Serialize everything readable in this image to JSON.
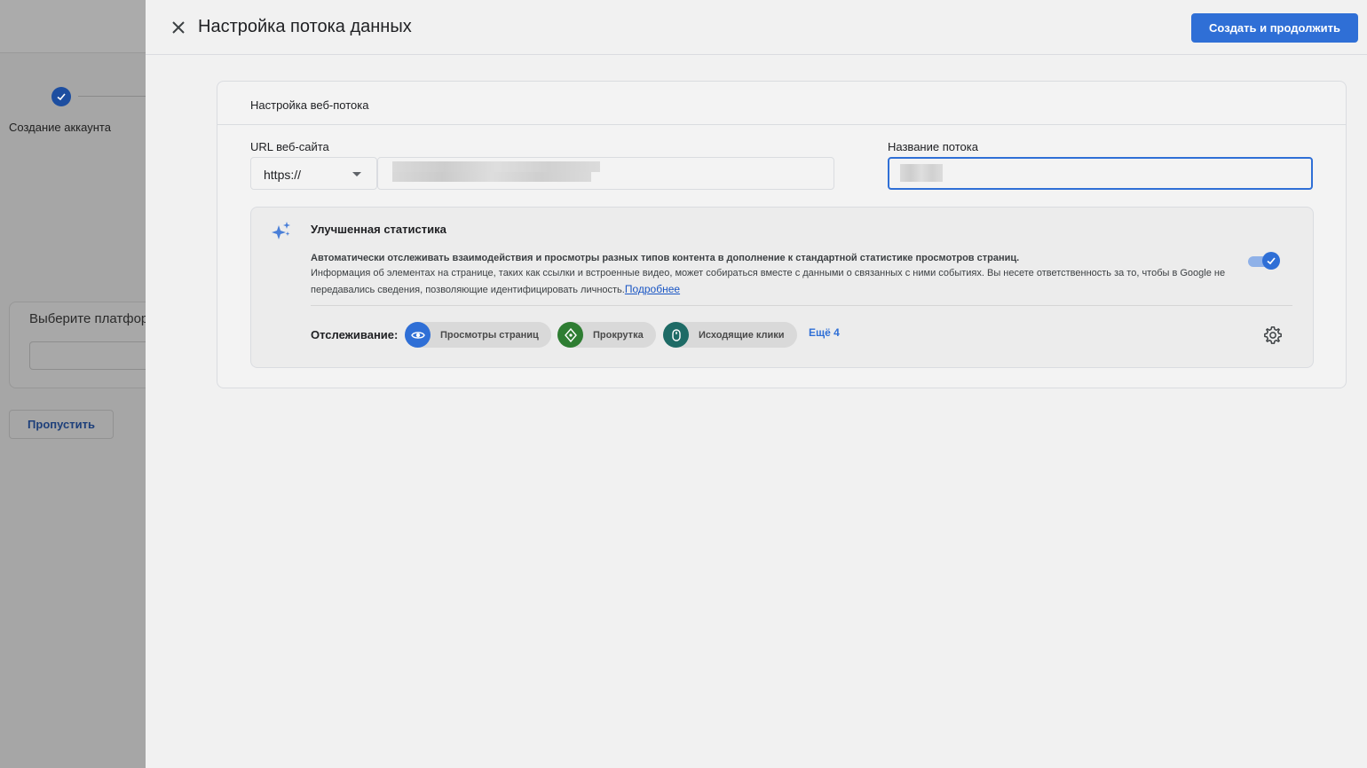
{
  "background": {
    "step_label": "Создание аккаунта",
    "platform_title": "Выберите платфор",
    "skip_button": "Пропустить"
  },
  "header": {
    "title": "Настройка потока данных",
    "primary_button": "Создать и продолжить",
    "close_icon": "close-icon"
  },
  "card": {
    "title": "Настройка веб-потока",
    "url_label": "URL веб-сайта",
    "protocol_value": "https://",
    "stream_name_label": "Название потока"
  },
  "enhanced": {
    "title": "Улучшенная статистика",
    "description_bold": "Автоматически отслеживать взаимодействия и просмотры разных типов контента в дополнение к стандартной статистике просмотров страниц.",
    "description": "Информация об элементах на странице, таких как ссылки и встроенные видео, может собираться вместе с данными о связанных с ними событиях. Вы несете ответственность за то, чтобы в Google не передавались сведения, позволяющие идентифицировать личность.",
    "learn_more": "Подробнее",
    "toggle_on": true,
    "tracking_label": "Отслеживание:",
    "chips": [
      {
        "label": "Просмотры страниц",
        "icon": "eye-icon",
        "color": "#2f6fd6"
      },
      {
        "label": "Прокрутка",
        "icon": "scroll-icon",
        "color": "#2e7d32"
      },
      {
        "label": "Исходящие клики",
        "icon": "mouse-icon",
        "color": "#1e6b66"
      }
    ],
    "more": "Ещё 4"
  },
  "colors": {
    "accent": "#2f6fd6",
    "panel_bg": "#f1f1f1"
  }
}
